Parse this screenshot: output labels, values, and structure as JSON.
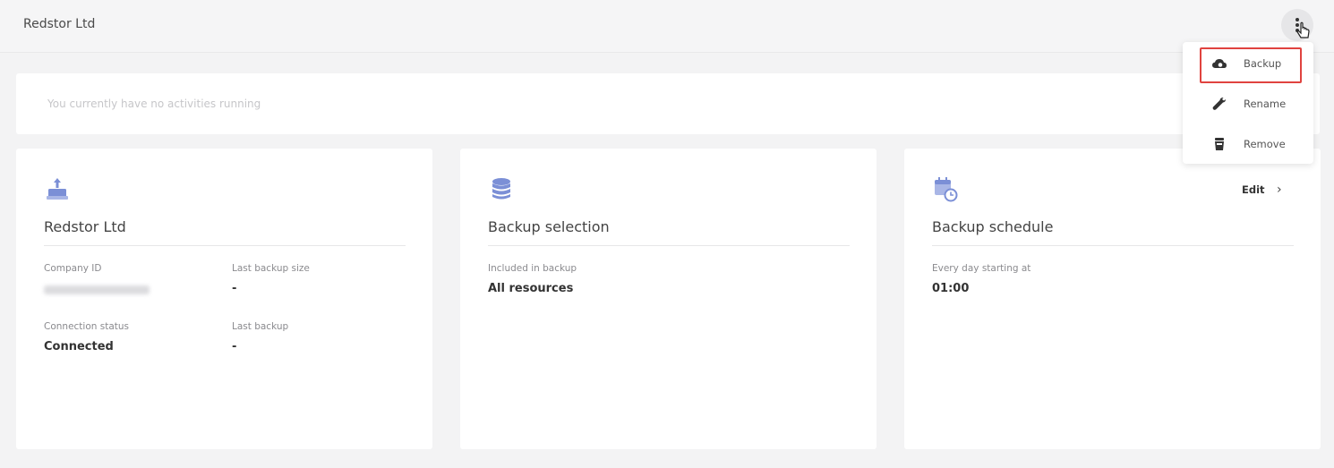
{
  "header": {
    "title": "Redstor Ltd"
  },
  "activity": {
    "message": "You currently have no activities running"
  },
  "menu": {
    "items": [
      {
        "label": "Backup",
        "icon": "cloud-backup-icon"
      },
      {
        "label": "Rename",
        "icon": "wrench-icon"
      },
      {
        "label": "Remove",
        "icon": "trash-icon"
      }
    ]
  },
  "company_card": {
    "icon": "upload-tray-icon",
    "title": "Redstor Ltd",
    "company_id_label": "Company ID",
    "last_backup_size_label": "Last backup size",
    "last_backup_size_value": "-",
    "connection_status_label": "Connection status",
    "connection_status_value": "Connected",
    "last_backup_label": "Last backup",
    "last_backup_value": "-"
  },
  "selection_card": {
    "icon": "database-icon",
    "title": "Backup selection",
    "included_label": "Included in backup",
    "included_value": "All resources"
  },
  "schedule_card": {
    "icon": "calendar-clock-icon",
    "title": "Backup schedule",
    "edit_label": "Edit",
    "frequency_label": "Every day starting at",
    "time_value": "01:00"
  },
  "colors": {
    "accent_icon": "#7b8fd6",
    "highlight": "#e0433f"
  }
}
